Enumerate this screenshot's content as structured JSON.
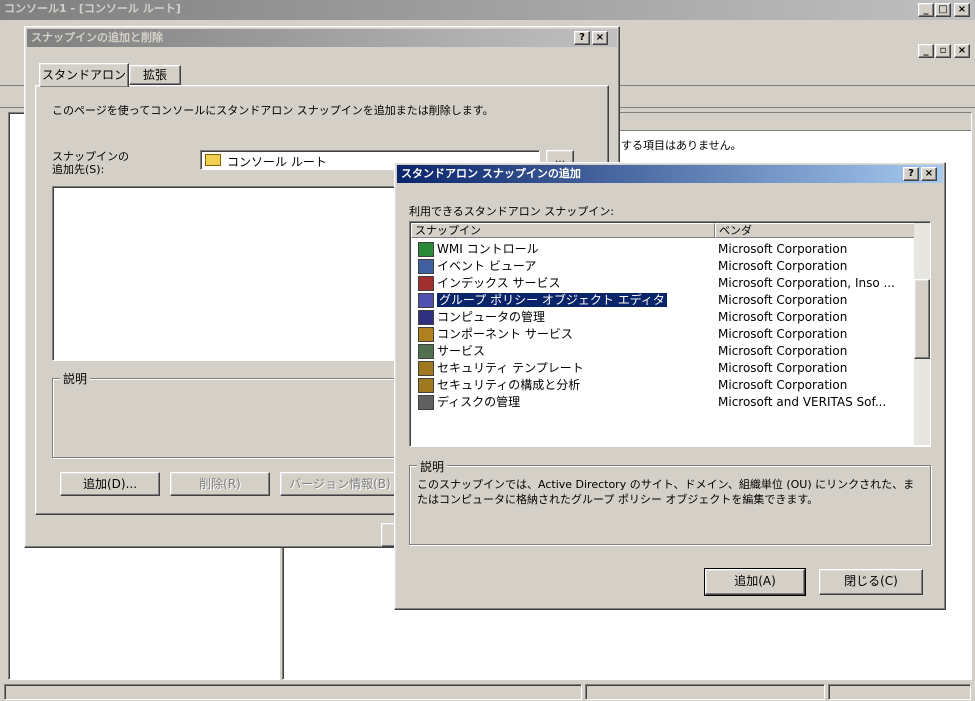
{
  "main_window": {
    "title": "コンソール1 - [コンソール ルート]",
    "status_segments": [
      "",
      "",
      ""
    ]
  },
  "right_pane": {
    "message": "する項目はありません。"
  },
  "add_remove_dialog": {
    "title": "スナップインの追加と削除",
    "help_btn": "?",
    "close_btn": "×",
    "tabs": [
      "スタンドアロン",
      "拡張"
    ],
    "description": "このページを使ってコンソールにスタンドアロン スナップインを追加または削除します。",
    "add_to_label": "スナップインの\n追加先(S):",
    "add_to_value": "コンソール ルート",
    "group_label": "説明",
    "buttons": [
      "追加(D)...",
      "削除(R)",
      "バージョン情報(B)"
    ]
  },
  "add_snapin_dialog": {
    "title": "スタンドアロン スナップインの追加",
    "help_btn": "?",
    "close_btn": "×",
    "list_label": "利用できるスタンドアロン スナップイン:",
    "columns": [
      "スナップイン",
      "ベンダ"
    ],
    "items": [
      {
        "name": "WMI コントロール",
        "vendor": "Microsoft Corporation",
        "icon": "wmi-icon"
      },
      {
        "name": "イベント ビューア",
        "vendor": "Microsoft Corporation",
        "icon": "event-viewer-icon"
      },
      {
        "name": "インデックス サービス",
        "vendor": "Microsoft Corporation, Inso ...",
        "icon": "index-service-icon"
      },
      {
        "name": "グループ ポリシー オブジェクト エディタ",
        "vendor": "Microsoft Corporation",
        "icon": "group-policy-icon"
      },
      {
        "name": "コンピュータの管理",
        "vendor": "Microsoft Corporation",
        "icon": "computer-management-icon"
      },
      {
        "name": "コンポーネント サービス",
        "vendor": "Microsoft Corporation",
        "icon": "component-services-icon"
      },
      {
        "name": "サービス",
        "vendor": "Microsoft Corporation",
        "icon": "services-icon"
      },
      {
        "name": "セキュリティ テンプレート",
        "vendor": "Microsoft Corporation",
        "icon": "security-template-icon"
      },
      {
        "name": "セキュリティの構成と分析",
        "vendor": "Microsoft Corporation",
        "icon": "security-analysis-icon"
      },
      {
        "name": "ディスクの管理",
        "vendor": "Microsoft and VERITAS Sof...",
        "icon": "disk-management-icon"
      }
    ],
    "selected_index": 3,
    "desc_label": "説明",
    "desc_text": "このスナップインでは、Active Directory のサイト、ドメイン、組織単位 (OU) にリンクされた、またはコンピュータに格納されたグループ ポリシー オブジェクトを編集できます。",
    "add_btn": "追加(A)",
    "close_dialog_btn": "閉じる(C)"
  }
}
